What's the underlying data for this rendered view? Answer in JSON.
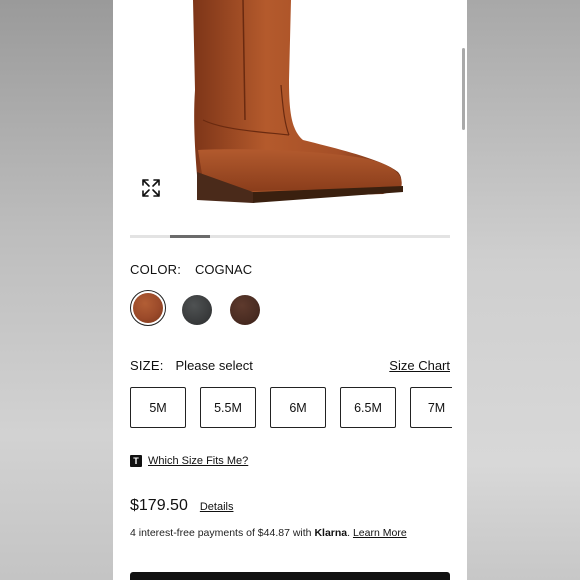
{
  "colors": {
    "swatch_cognac": "#9b4a2a",
    "swatch_black": "#3a3c3d",
    "swatch_brown": "#4a2c22",
    "boot_main": "#a24e28",
    "boot_heel": "#4a2a1a"
  },
  "icons": {
    "expand": "expand-arrows-icon",
    "size_info": "t-badge-icon"
  },
  "color_selector": {
    "label": "COLOR:",
    "selected": "COGNAC",
    "swatches": [
      "cognac",
      "black",
      "brown"
    ]
  },
  "size_selector": {
    "label": "SIZE:",
    "selected": "Please select",
    "chart_link": "Size Chart",
    "sizes": [
      "5M",
      "5.5M",
      "6M",
      "6.5M",
      "7M"
    ]
  },
  "fit_link": "Which Size Fits Me?",
  "price": {
    "amount": "$179.50",
    "details_link": "Details"
  },
  "klarna": {
    "prefix": "4 interest-free payments of $44.87 with ",
    "brand": "Klarna",
    "suffix": ". ",
    "learn_more": "Learn More"
  }
}
